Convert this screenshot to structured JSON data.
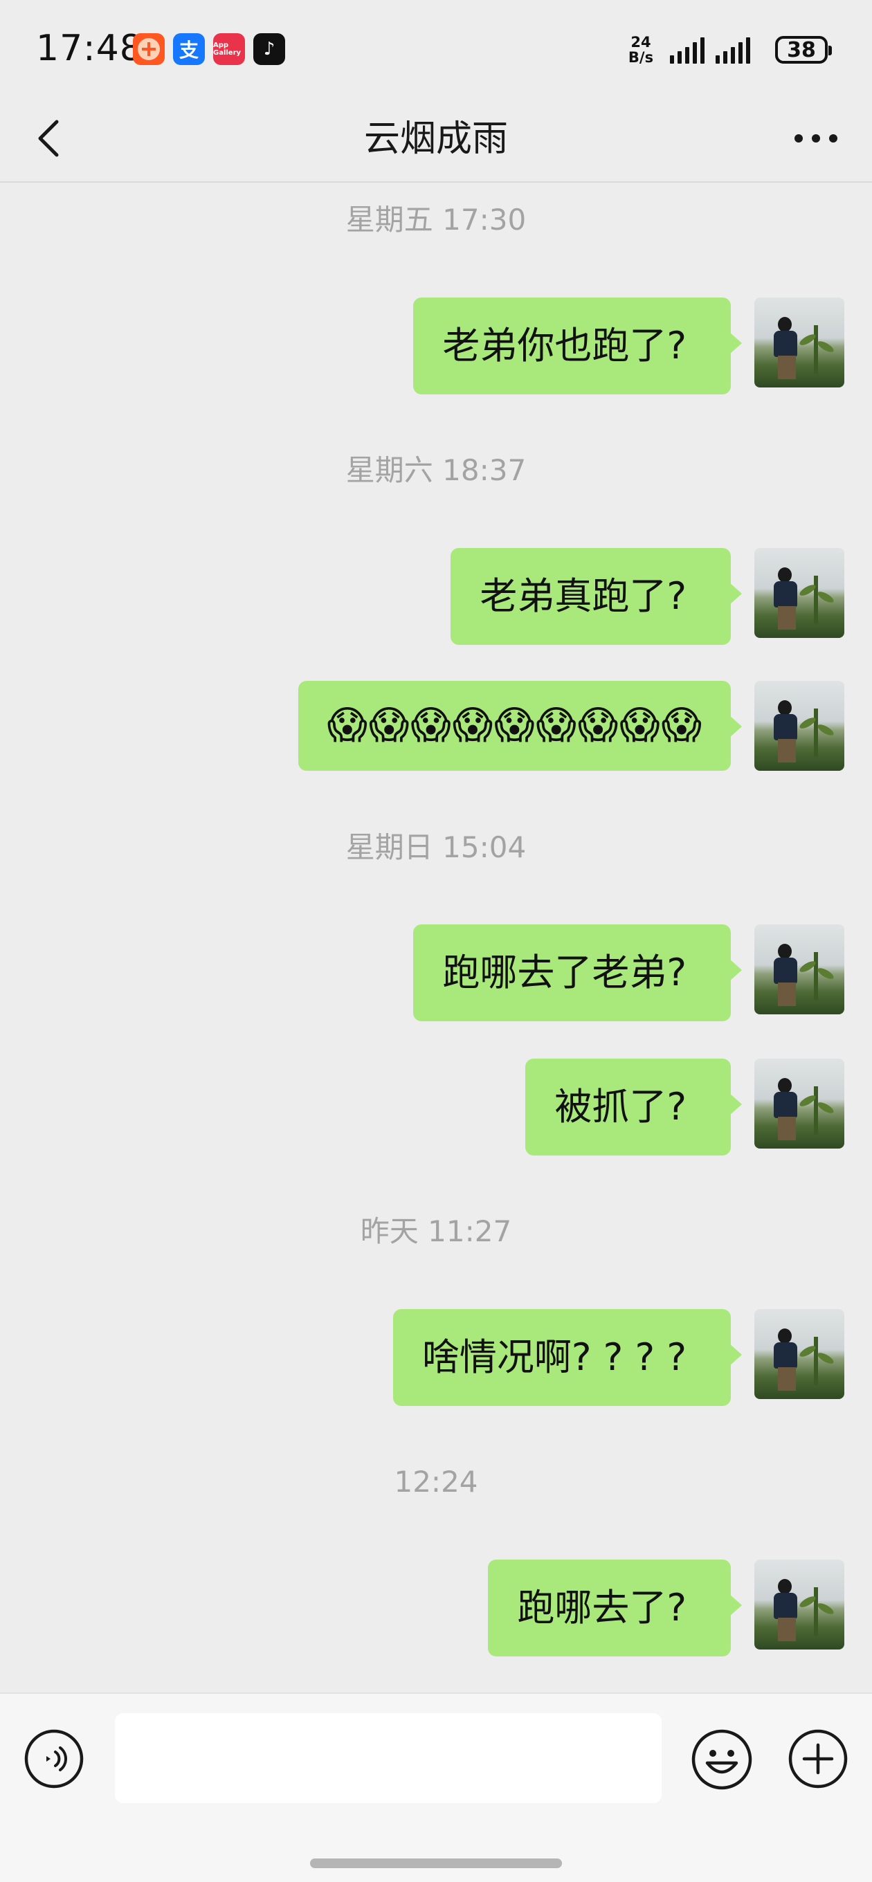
{
  "status_bar": {
    "time": "17:48",
    "speed_value": "24",
    "speed_unit": "B/s",
    "battery": "38",
    "app_icons": [
      "taobao-icon",
      "alipay-icon",
      "app-gallery-icon",
      "tiktok-icon"
    ],
    "alipay_glyph": "支",
    "gallery_label": "App Gallery",
    "tiktok_glyph": "♪"
  },
  "nav": {
    "title": "云烟成雨"
  },
  "messages": [
    {
      "time": "星期五 17:30"
    },
    {
      "text": "老弟你也跑了?"
    },
    {
      "time": "星期六 18:37"
    },
    {
      "text": "老弟真跑了?"
    },
    {
      "text": "😱😱😱😱😱😱😱😱😱"
    },
    {
      "time": "星期日 15:04"
    },
    {
      "text": "跑哪去了老弟?"
    },
    {
      "text": "被抓了?"
    },
    {
      "time": "昨天 11:27"
    },
    {
      "text": "啥情况啊? ? ? ?"
    },
    {
      "time": "12:24"
    },
    {
      "text": "跑哪去了?"
    }
  ],
  "input": {
    "value": "",
    "placeholder": ""
  },
  "colors": {
    "background": "#ededed",
    "bubble_self": "#a9e87a",
    "timestamp": "#a3a3a3",
    "input_bar": "#f6f6f6"
  }
}
